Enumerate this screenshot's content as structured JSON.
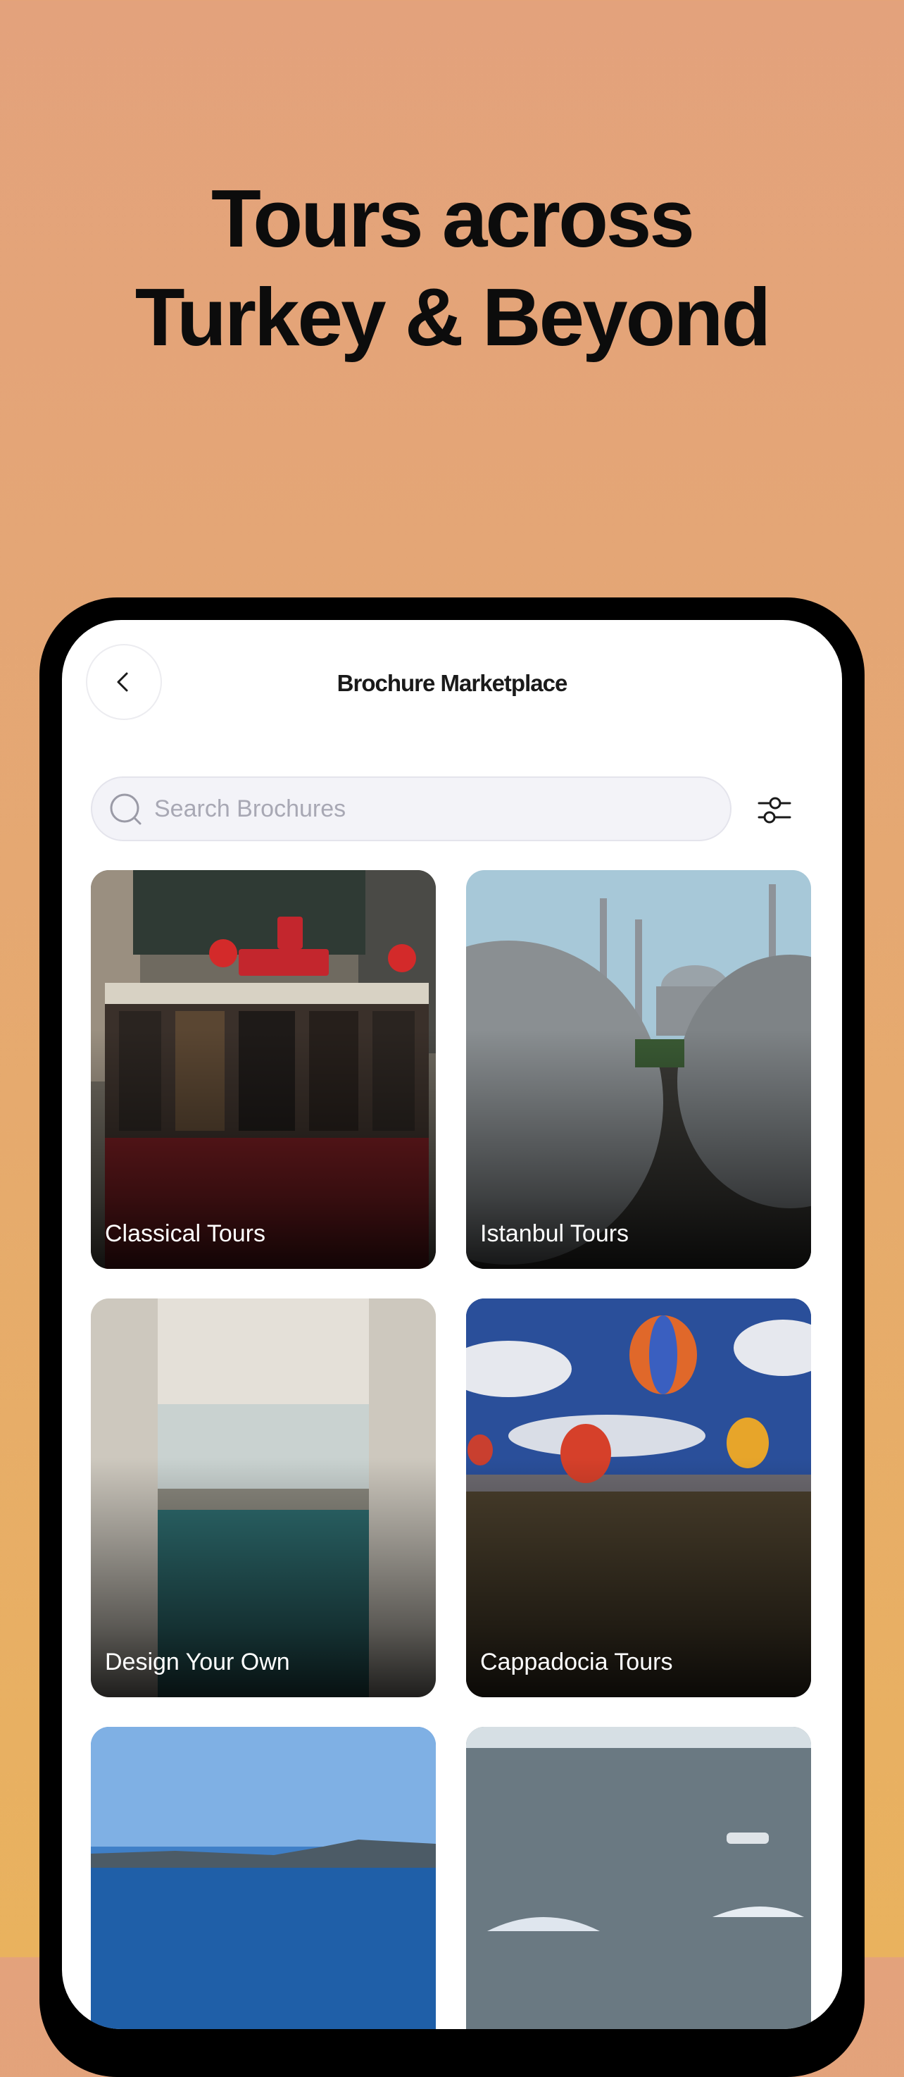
{
  "promo": {
    "headline_line1": "Tours across",
    "headline_line2": "Turkey & Beyond",
    "background_color": "#e3a27c"
  },
  "header": {
    "back_icon": "chevron-left-icon",
    "title": "Brochure Marketplace"
  },
  "search": {
    "placeholder": "Search Brochures",
    "icon": "search-icon",
    "filter_icon": "sliders-icon"
  },
  "categories": [
    {
      "label": "Classical Tours",
      "image": "tram-street-photo"
    },
    {
      "label": "Istanbul Tours",
      "image": "mosque-domes-photo"
    },
    {
      "label": "Design Your Own",
      "image": "ornate-window-sea-photo"
    },
    {
      "label": "Cappadocia Tours",
      "image": "hot-air-balloons-photo"
    },
    {
      "label": "",
      "image": "aegean-coast-photo"
    },
    {
      "label": "",
      "image": "sea-umbrellas-photo"
    }
  ]
}
